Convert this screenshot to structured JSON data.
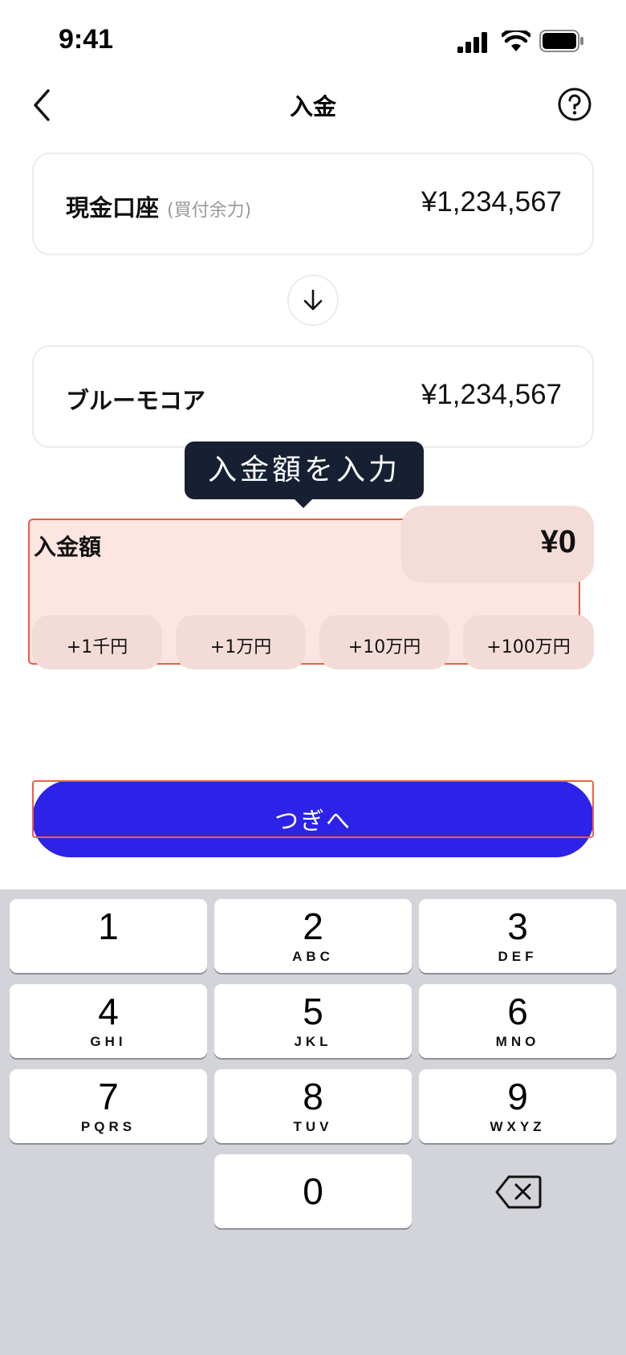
{
  "status_bar": {
    "time": "9:41"
  },
  "nav": {
    "title": "入金"
  },
  "from_account": {
    "label": "現金口座",
    "sublabel": "(買付余力)",
    "amount": "¥1,234,567"
  },
  "to_account": {
    "label": "ブルーモコア",
    "amount": "¥1,234,567"
  },
  "tooltip": {
    "text": "入金額を入力"
  },
  "amount": {
    "label": "入金額",
    "value": "¥0"
  },
  "quick_amounts": [
    "+1千円",
    "+1万円",
    "+10万円",
    "+100万円"
  ],
  "next_button": {
    "label": "つぎへ"
  },
  "keypad": {
    "keys": [
      {
        "num": "1",
        "letters": ""
      },
      {
        "num": "2",
        "letters": "ABC"
      },
      {
        "num": "3",
        "letters": "DEF"
      },
      {
        "num": "4",
        "letters": "GHI"
      },
      {
        "num": "5",
        "letters": "JKL"
      },
      {
        "num": "6",
        "letters": "MNO"
      },
      {
        "num": "7",
        "letters": "PQRS"
      },
      {
        "num": "8",
        "letters": "TUV"
      },
      {
        "num": "9",
        "letters": "WXYZ"
      },
      {
        "num": "0",
        "letters": ""
      }
    ]
  },
  "colors": {
    "primary": "#2d22e8",
    "tooltip_bg": "#172033",
    "highlight_border": "#ec5d45",
    "highlight_fill": "#fde5e1",
    "keyboard_bg": "#d3d4d9"
  },
  "icons": {
    "back": "chevron-left-icon",
    "help": "question-circle-icon",
    "transfer": "arrow-down-icon",
    "delete": "backspace-icon",
    "signal": "cellular-signal-icon",
    "wifi": "wifi-icon",
    "battery": "battery-icon"
  }
}
